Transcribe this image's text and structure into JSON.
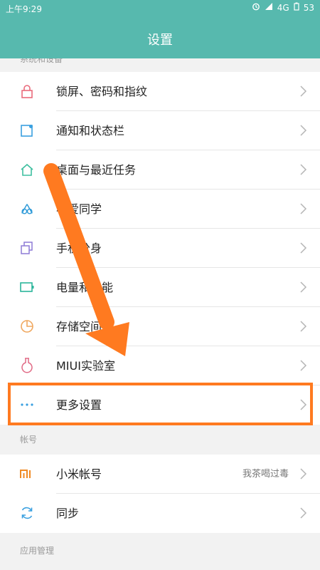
{
  "status_bar": {
    "time": "上午9:29",
    "network": "4G",
    "battery": "53"
  },
  "header": {
    "title": "设置"
  },
  "sections": [
    {
      "label": "系统和设备",
      "items": [
        {
          "label": "锁屏、密码和指纹",
          "icon": "lock-icon"
        },
        {
          "label": "通知和状态栏",
          "icon": "notification-icon"
        },
        {
          "label": "桌面与最近任务",
          "icon": "home-icon"
        },
        {
          "label": "小爱同学",
          "icon": "xiaoai-icon"
        },
        {
          "label": "手机分身",
          "icon": "second-space-icon"
        },
        {
          "label": "电量和性能",
          "icon": "battery-icon"
        },
        {
          "label": "存储空间",
          "icon": "storage-icon"
        },
        {
          "label": "MIUI实验室",
          "icon": "lab-flask-icon"
        },
        {
          "label": "更多设置",
          "icon": "more-dots-icon"
        }
      ]
    },
    {
      "label": "帐号",
      "items": [
        {
          "label": "小米帐号",
          "value": "我茶喝过毒",
          "icon": "mi-logo-icon"
        },
        {
          "label": "同步",
          "icon": "sync-icon"
        }
      ]
    },
    {
      "label": "应用管理",
      "items": []
    }
  ],
  "colors": {
    "header_bg": "#57b9ae",
    "highlight": "#ff7a20"
  }
}
